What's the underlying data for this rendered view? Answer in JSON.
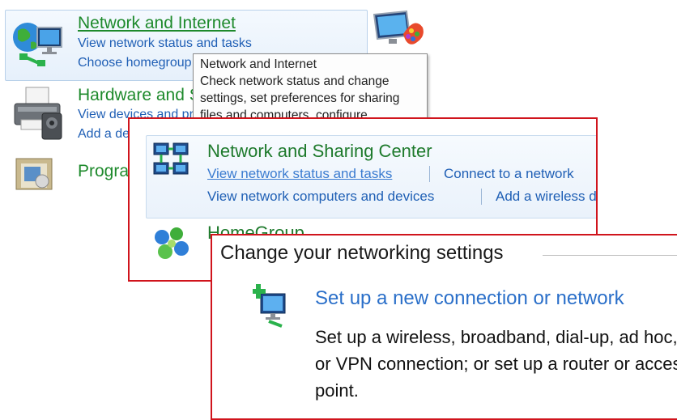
{
  "control_panel": {
    "network": {
      "title": "Network and Internet",
      "link1": "View network status and tasks",
      "link2": "Choose homegroup"
    },
    "hardware": {
      "title": "Hardware and Sound",
      "link1": "View devices and printers",
      "link2": "Add a device"
    },
    "programs": {
      "title": "Programs"
    }
  },
  "tooltip": {
    "title": "Network and Internet",
    "line1": "Check network status and change",
    "line2": "settings, set preferences for sharing",
    "line3": "files and computers, configure"
  },
  "network_page": {
    "nsc_title": "Network and Sharing Center",
    "link_status": "View network status and tasks",
    "link_connect": "Connect to a network",
    "link_computers": "View network computers and devices",
    "link_wireless": "Add a wireless device to the network",
    "homegroup_title": "HomeGroup"
  },
  "networking_settings": {
    "heading": "Change your networking settings",
    "setup_link": "Set up a new connection or network",
    "setup_desc": "Set up a wireless, broadband, dial-up, ad hoc, or VPN connection; or set up a router or access point."
  },
  "colors": {
    "highlight_border": "#d0141c",
    "category_title": "#1e8a2c",
    "link": "#1f5fb5"
  }
}
